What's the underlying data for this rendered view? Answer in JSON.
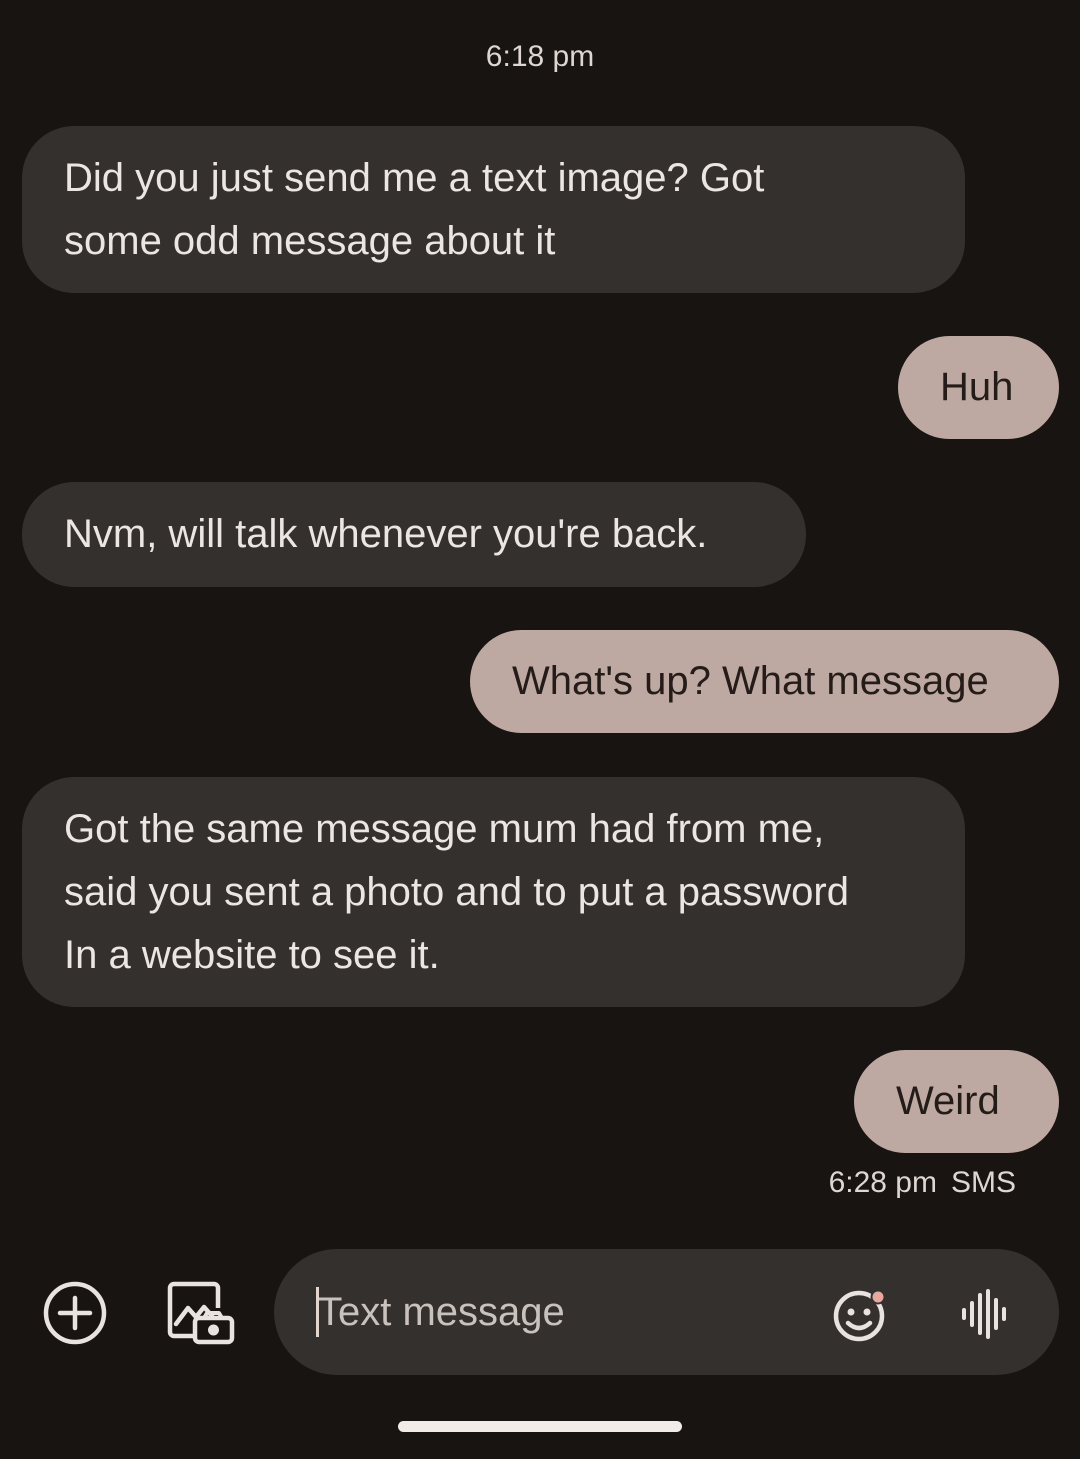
{
  "conversation": {
    "timestamp": "6:18 pm",
    "messages": [
      {
        "direction": "incoming",
        "lines": [
          "Did you just send me a text image? Got",
          "some odd message about it"
        ]
      },
      {
        "direction": "outgoing",
        "lines": [
          "Huh"
        ]
      },
      {
        "direction": "incoming",
        "lines": [
          "Nvm, will talk whenever you're back."
        ]
      },
      {
        "direction": "outgoing",
        "lines": [
          "What's up? What message"
        ]
      },
      {
        "direction": "incoming",
        "lines": [
          "Got the same message mum had from me,",
          "said you sent a photo and to put a password",
          "In a website to see it."
        ]
      },
      {
        "direction": "outgoing",
        "lines": [
          "Weird"
        ]
      }
    ],
    "last_message_meta": {
      "time": "6:28 pm",
      "type": "SMS"
    }
  },
  "composer": {
    "placeholder": "Text message",
    "icons": {
      "add": "add-circle-icon",
      "gallery": "gallery-camera-icon",
      "emoji": "emoji-icon",
      "voice": "voice-waveform-icon"
    }
  },
  "colors": {
    "background": "#181411",
    "incoming_bubble": "#34302e",
    "outgoing_bubble": "#bea9a2",
    "emoji_badge": "#e8a8a0"
  }
}
